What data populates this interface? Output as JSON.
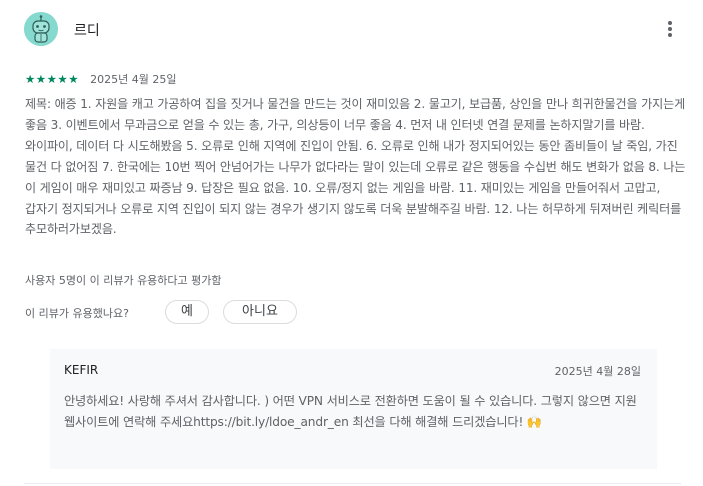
{
  "review": {
    "author": "르디",
    "rating": 5,
    "stars": "★★★★★",
    "date": "2025년 4월 25일",
    "text": "제목: 애증 1. 자원을 캐고 가공하여 집을 짓거나 물건을 만드는 것이 재미있음 2. 물고기, 보급품, 상인을 만나 희귀한물건을 가지는게 좋음 3. 이벤트에서 무과금으로 얻을 수 있는 총, 가구, 의상등이 너무 좋음 4. 먼저 내 인터넷 연결 문제를 논하지말기를 바람. 와이파이, 데이터 다 시도해봤음 5. 오류로 인해 지역에 진입이 안됨. 6. 오류로 인해 내가 정지되어있는 동안 좀비들이 날 죽임, 가진 물건 다 없어짐 7. 한국에는 10번 찍어 안넘어가는 나무가 없다라는 말이 있는데 오류로 같은 행동을 수십번 해도 변화가 없음 8. 나는 이 게임이 매우 재미있고 짜증남 9. 답장은 필요 없음. 10. 오류/정지 없는 게임을 바람. 11. 재미있는 게임을 만들어줘서 고맙고, 갑자기 정지되거나 오류로 지역 진입이 되지 않는 경우가 생기지 않도록 더욱 분발해주길 바람. 12. 나는 허무하게 뒤져버린 케릭터를 추모하러가보겠음.",
    "helpful_count_text": "사용자 5명이 이 리뷰가 유용하다고 평가함",
    "helpful_question": "이 리뷰가 유용했나요?",
    "yes_label": "예",
    "no_label": "아니요"
  },
  "reply": {
    "developer": "KEFIR",
    "date": "2025년 4월 28일",
    "text": "안녕하세요! 사랑해 주셔서 감사합니다. ) 어떤 VPN 서비스로 전환하면 도움이 될 수 있습니다. 그렇지 않으면 지원 웹사이트에 연락해 주세요https://bit.ly/ldoe_andr_en 최선을 다해 해결해 드리겠습니다! 🙌"
  },
  "icons": {
    "avatar": "robot-avatar-icon",
    "menu": "more-vert-icon",
    "star": "star-icon"
  },
  "colors": {
    "star": "#01875f",
    "avatar_bg": "#86d9ce",
    "reply_bg": "#f8f9fa"
  }
}
